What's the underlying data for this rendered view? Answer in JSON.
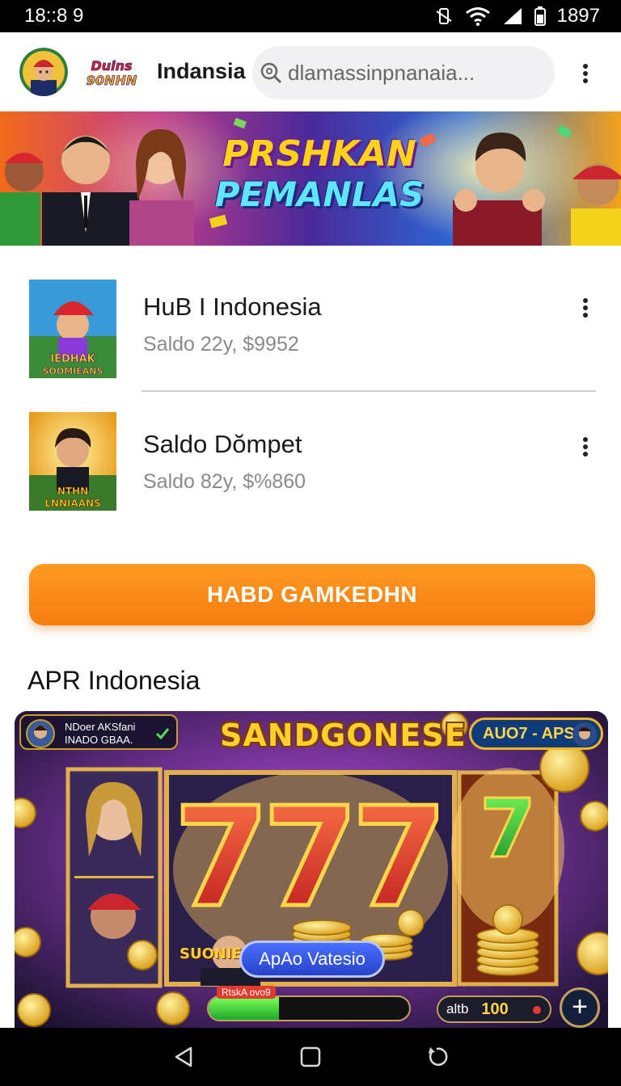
{
  "status": {
    "time": "18::8 9",
    "battery": "1897"
  },
  "header": {
    "logo_text": [
      "Duins",
      "90NHN"
    ],
    "title": "Indansia",
    "search_value": "dlamassinpnanaia..."
  },
  "banner": {
    "line1": "PRSHKAN",
    "line2": "PEMANLAS"
  },
  "wallets": [
    {
      "title": "HuB I Indonesia",
      "subtitle": "Saldo 22y, $9952",
      "thumb_caption": [
        "IEDHAK",
        "SOOMIEANS"
      ]
    },
    {
      "title": "Saldo Dŏmpet",
      "subtitle": "Saldo 82y, $%860",
      "thumb_caption": [
        "NTHN",
        "LNNIAANS"
      ]
    }
  ],
  "cta_label": "HABD GAMKEDHN",
  "section_title": "APR Indonesia",
  "game": {
    "title": "SANDGONESE",
    "player_line1": "NDoer AKSfani",
    "player_line2": "INADO GBAA.",
    "auto_label": "AUO7 - APS4",
    "reel_label": "SUONIES",
    "play_label": "ApAo Vatesio",
    "progress_label": "RtskA ovo9",
    "progress_value": 0.35,
    "bet_label": "altb",
    "bet_value": "100",
    "plus_label": "+"
  },
  "colors": {
    "accent": "#f57d10",
    "status_bar": "#000000",
    "nav_bar": "#000000"
  }
}
